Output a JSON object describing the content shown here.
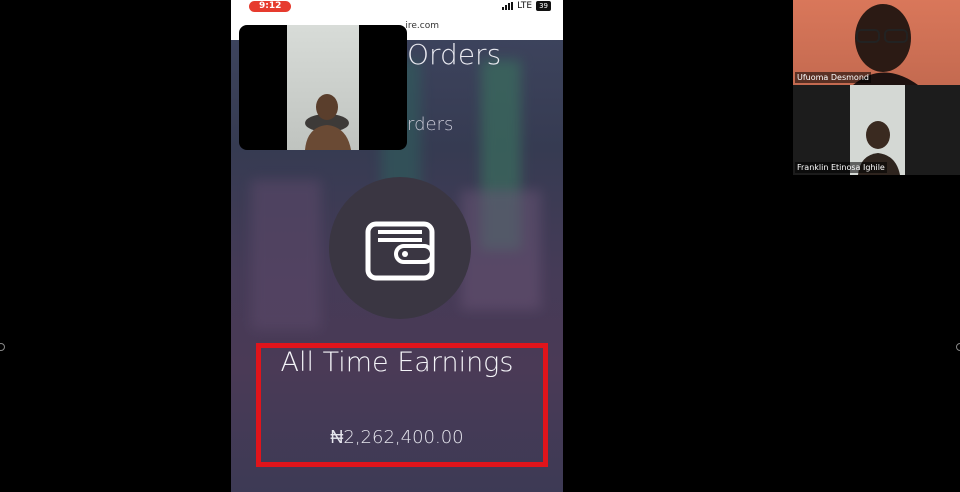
{
  "phone": {
    "status_time": "9:12",
    "network": "LTE",
    "battery": "39",
    "url_fragment": "ire.com"
  },
  "page": {
    "heading": "Orders",
    "subheading": "rders",
    "earnings_title": "All Time Earnings",
    "earnings_amount": "₦2,262,400.00",
    "wallet_icon": "wallet-icon"
  },
  "participants": [
    {
      "name": "Ufuoma Desmond"
    },
    {
      "name": "Franklin Etinosa Ighile"
    }
  ],
  "colors": {
    "highlight": "#e0141b",
    "time_pill": "#e63b2e"
  }
}
